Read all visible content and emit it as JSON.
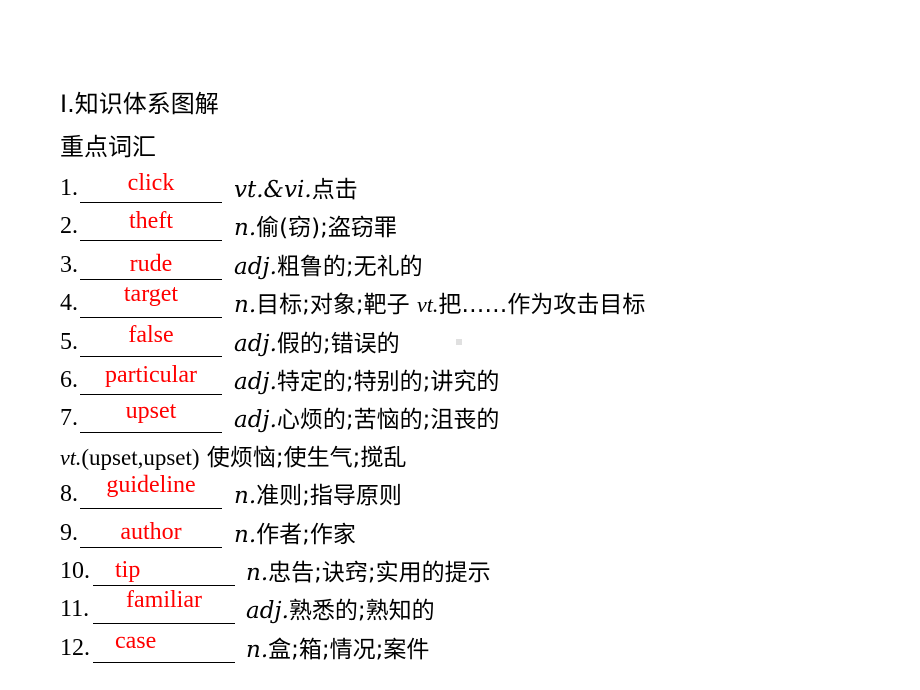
{
  "section_title": {
    "roman": "Ⅰ",
    "text": ".知识体系图解"
  },
  "subtitle": "重点词汇",
  "items": [
    {
      "num": "1.",
      "answer": "click",
      "pos": "vt.&vi.",
      "meaning": "点击"
    },
    {
      "num": "2.",
      "answer": "theft",
      "pos": "n.",
      "meaning": "偷(窃);盗窃罪"
    },
    {
      "num": "3.",
      "answer": "rude",
      "pos": "adj.",
      "meaning": "粗鲁的;无礼的"
    },
    {
      "num": "4.",
      "answer": "target",
      "pos": "n.",
      "meaning": "目标;对象;靶子 ",
      "pos2": "vt.",
      "meaning2": "把……作为攻击目标"
    },
    {
      "num": "5.",
      "answer": "false",
      "pos": "adj.",
      "meaning": "假的;错误的"
    },
    {
      "num": "6.",
      "answer": "particular",
      "pos": "adj.",
      "meaning": "特定的;特别的;讲究的"
    },
    {
      "num": "7.",
      "answer": "upset",
      "pos": "adj.",
      "meaning": "心烦的;苦恼的;沮丧的"
    },
    {
      "num": "8.",
      "answer": "guideline",
      "pos": "n.",
      "meaning": "准则;指导原则"
    },
    {
      "num": "9.",
      "answer": "author",
      "pos": "n.",
      "meaning": "作者;作家"
    },
    {
      "num": "10.",
      "answer": "tip",
      "pos": "n.",
      "meaning": "忠告;诀窍;实用的提示"
    },
    {
      "num": "11.",
      "answer": "familiar",
      "pos": "adj.",
      "meaning": "熟悉的;熟知的"
    },
    {
      "num": "12.",
      "answer": "case",
      "pos": "n.",
      "meaning": "盒;箱;情况;案件"
    }
  ],
  "upset_extra": {
    "pos": "vt.",
    "forms": "(upset,upset)",
    "meaning": " 使烦恼;使生气;搅乱"
  },
  "colors": {
    "answer": "#ff0000",
    "text": "#000000"
  }
}
